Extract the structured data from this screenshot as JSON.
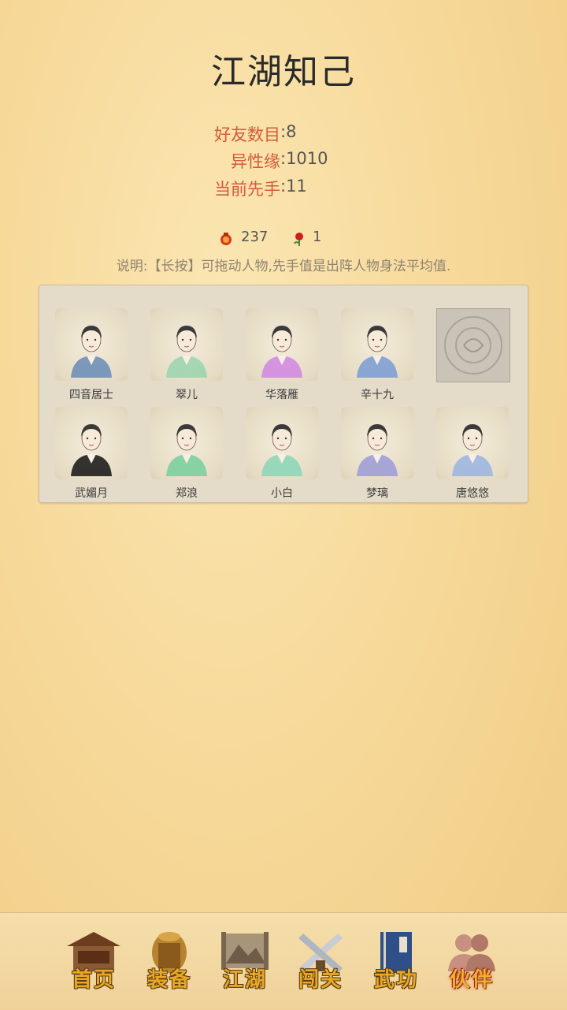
{
  "title": "江湖知己",
  "stats": {
    "friends": {
      "label": "好友数目",
      "value": ":8"
    },
    "romance": {
      "label": "异性缘",
      "value": ":1010"
    },
    "initiative": {
      "label": "当前先手",
      "value": ":11"
    }
  },
  "gifts": {
    "pouch_count": "237",
    "rose_count": "1"
  },
  "note": "说明:【长按】可拖动人物,先手值是出阵人物身法平均值.",
  "characters": [
    {
      "name": "四音居士",
      "robe": "#6f8fb8"
    },
    {
      "name": "翠儿",
      "robe": "#9fd4b0"
    },
    {
      "name": "华落雁",
      "robe": "#d28be0"
    },
    {
      "name": "辛十九",
      "robe": "#7f9fd2"
    },
    {
      "name": "",
      "locked": true
    },
    {
      "name": "武媚月",
      "robe": "#1e1e1e"
    },
    {
      "name": "郑浪",
      "robe": "#7ccf9f"
    },
    {
      "name": "小白",
      "robe": "#8fd6b8"
    },
    {
      "name": "梦璃",
      "robe": "#9f9fd6"
    },
    {
      "name": "唐悠悠",
      "robe": "#9fb6e0"
    }
  ],
  "nav": [
    {
      "label": "首页",
      "icon": "house-icon"
    },
    {
      "label": "装备",
      "icon": "armor-icon"
    },
    {
      "label": "江湖",
      "icon": "scroll-map-icon"
    },
    {
      "label": "闯关",
      "icon": "crossed-swords-icon"
    },
    {
      "label": "武功",
      "icon": "book-icon"
    },
    {
      "label": "伙伴",
      "icon": "partners-icon",
      "active": true
    }
  ],
  "colors": {
    "label_red": "#d55a3a",
    "nav_gold": "#e8a726"
  }
}
